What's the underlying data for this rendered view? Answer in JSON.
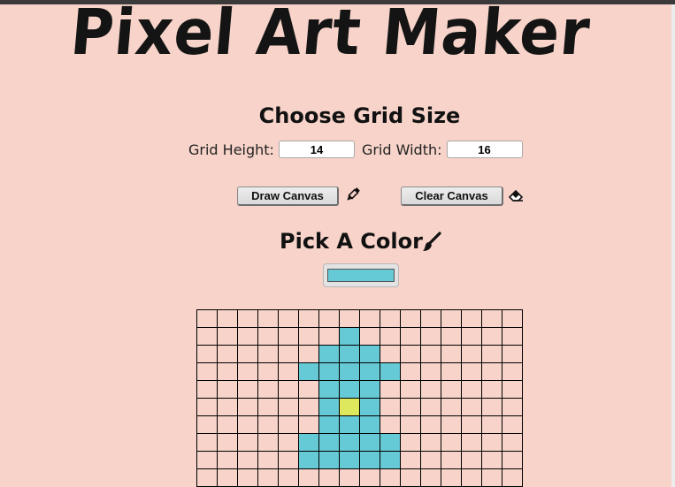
{
  "page": {
    "title": "Pixel Art Maker"
  },
  "grid_size": {
    "heading": "Choose Grid Size",
    "height_label": "Grid Height:",
    "height_value": "14",
    "width_label": "Grid Width:",
    "width_value": "16"
  },
  "actions": {
    "draw_label": "Draw Canvas",
    "draw_icon": "pencil-icon",
    "clear_label": "Clear Canvas",
    "clear_icon": "eraser-icon"
  },
  "color": {
    "heading": "Pick A Color",
    "heading_icon": "paintbrush-icon",
    "selected": "#66c9d6"
  },
  "canvas": {
    "columns": 16,
    "visible_rows": 10,
    "palette": {
      "0": "",
      "1": "#66c9d6",
      "2": "#dde85c"
    },
    "rows": [
      "0000000000000000",
      "0000000100000000",
      "0000001110000000",
      "0000011111000000",
      "0000001110000000",
      "0000001210000000",
      "0000001110000000",
      "0000011111000000",
      "0000011111000000",
      "0000000000000000"
    ]
  },
  "colors": {
    "page_background": "#f7d3c9",
    "cyan": "#66c9d6",
    "yellow": "#dde85c"
  }
}
